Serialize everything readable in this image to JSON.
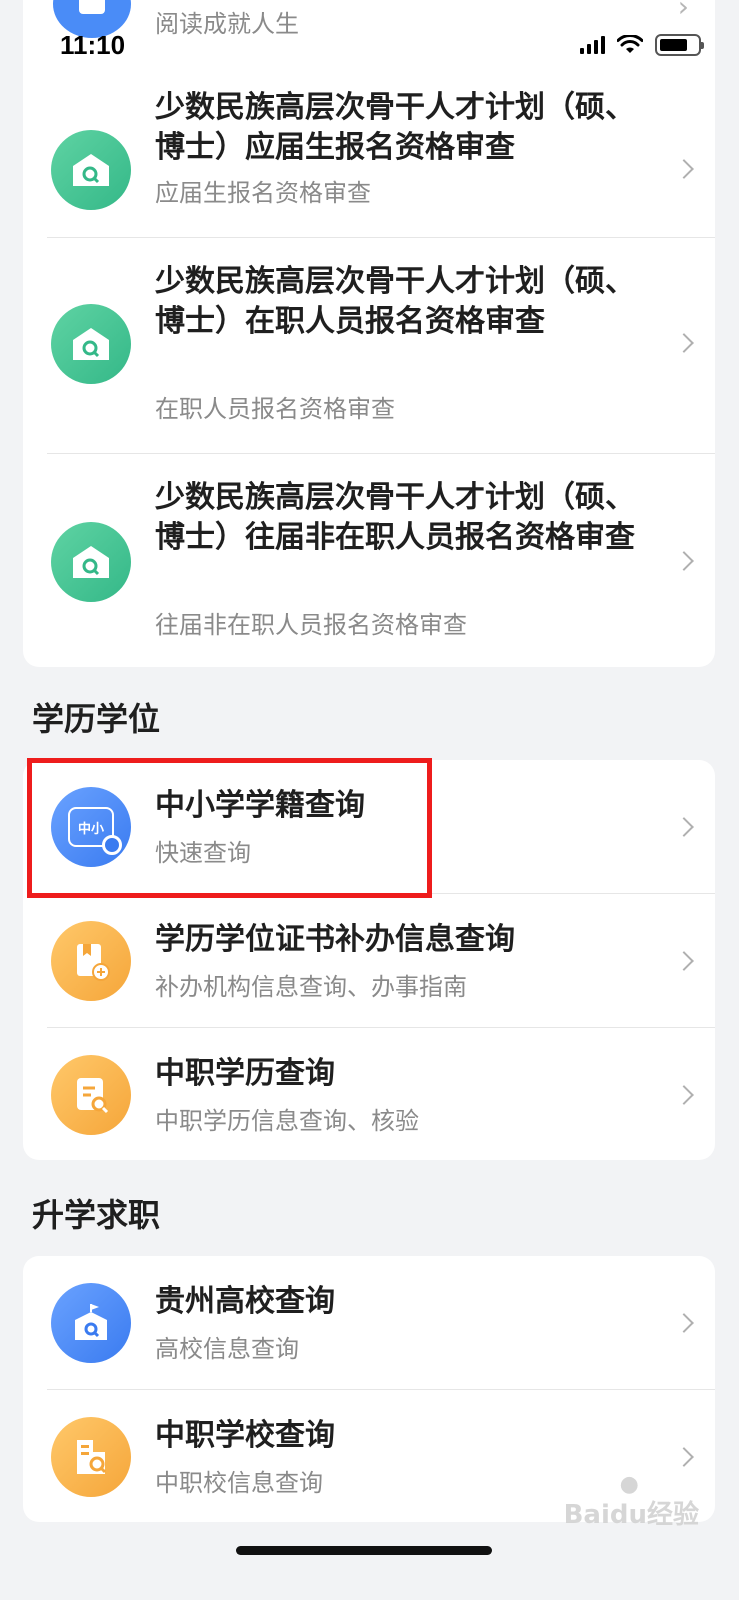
{
  "status_bar": {
    "time": "11:10",
    "battery_level": 0.75
  },
  "top_peek": {
    "subtitle": "阅读成就人生"
  },
  "group_top": {
    "items": [
      {
        "title": "少数民族高层次骨干人才计划（硕、博士）应届生报名资格审查",
        "subtitle": "应届生报名资格审查",
        "icon": "school-search-icon"
      },
      {
        "title": "少数民族高层次骨干人才计划（硕、博士）在职人员报名资格审查",
        "subtitle": "在职人员报名资格审查",
        "icon": "school-search-icon"
      },
      {
        "title": "少数民族高层次骨干人才计划（硕、博士）往届非在职人员报名资格审查",
        "subtitle": "往届非在职人员报名资格审查",
        "icon": "school-search-icon"
      }
    ]
  },
  "section_education": {
    "title": "学历学位",
    "items": [
      {
        "title": "中小学学籍查询",
        "subtitle": "快速查询",
        "icon_text": "中小",
        "icon": "student-search-icon"
      },
      {
        "title": "学历学位证书补办信息查询",
        "subtitle": "补办机构信息查询、办事指南",
        "icon": "certificate-add-icon"
      },
      {
        "title": "中职学历查询",
        "subtitle": "中职学历信息查询、核验",
        "icon": "document-search-icon"
      }
    ]
  },
  "section_career": {
    "title": "升学求职",
    "items": [
      {
        "title": "贵州高校查询",
        "subtitle": "高校信息查询",
        "icon": "university-search-icon"
      },
      {
        "title": "中职学校查询",
        "subtitle": "中职校信息查询",
        "icon": "building-search-icon"
      }
    ]
  },
  "watermark": {
    "text": "Baidu经验"
  },
  "colors": {
    "highlight": "#ee1c1c",
    "green": "#34b888",
    "blue": "#3a7bf0",
    "orange": "#f5a63a"
  }
}
